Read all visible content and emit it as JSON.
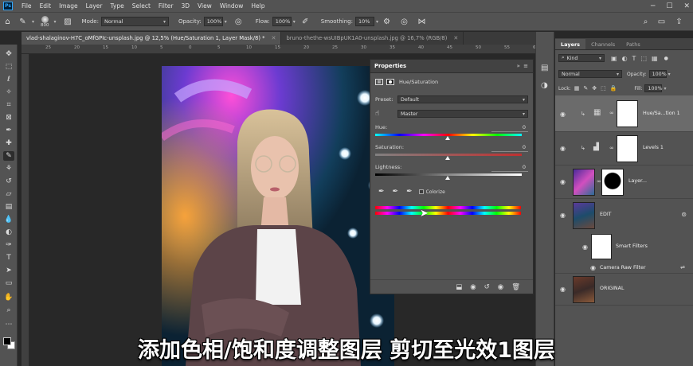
{
  "menu": {
    "app_logo": "Ps",
    "items": [
      "File",
      "Edit",
      "Image",
      "Layer",
      "Type",
      "Select",
      "Filter",
      "3D",
      "View",
      "Window",
      "Help"
    ]
  },
  "options_bar": {
    "brush_size": "800",
    "mode_label": "Mode:",
    "mode_value": "Normal",
    "opacity_label": "Opacity:",
    "opacity_value": "100%",
    "flow_label": "Flow:",
    "flow_value": "100%",
    "smoothing_label": "Smoothing:",
    "smoothing_value": "10%"
  },
  "tabs": [
    {
      "label": "vlad-shalaginov-H7C_oMfGPIc-unsplash.jpg @ 12,5% (Hue/Saturation 1, Layer Mask/8) *",
      "active": true
    },
    {
      "label": "bruno-thethe-wsUIBpUK1A0-unsplash.jpg @ 16,7% (RGB/8)",
      "active": false
    }
  ],
  "ruler_ticks": [
    "25",
    "20",
    "15",
    "10",
    "5",
    "0",
    "5",
    "10",
    "15",
    "20",
    "25",
    "30",
    "35",
    "40",
    "45",
    "50",
    "55",
    "60"
  ],
  "properties": {
    "tab": "Properties",
    "type_label": "Hue/Saturation",
    "preset_label": "Preset:",
    "preset_value": "Default",
    "channel_value": "Master",
    "hue_label": "Hue:",
    "hue_value": "0",
    "saturation_label": "Saturation:",
    "saturation_value": "0",
    "lightness_label": "Lightness:",
    "lightness_value": "0",
    "colorize_label": "Colorize"
  },
  "layers_panel": {
    "tabs": [
      "Layers",
      "Channels",
      "Paths"
    ],
    "kind_label": "Kind",
    "blend_mode": "Normal",
    "opacity_label": "Opacity:",
    "opacity_value": "100%",
    "lock_label": "Lock:",
    "fill_label": "Fill:",
    "fill_value": "100%",
    "layers": [
      {
        "name": "Hue/Sa...tion 1"
      },
      {
        "name": "Levels 1"
      },
      {
        "name": "Layer..."
      },
      {
        "name": "EDIT"
      },
      {
        "name": "Smart Filters"
      },
      {
        "name": "Camera Raw Filter"
      },
      {
        "name": "ORIGINAL"
      }
    ]
  },
  "subtitle": "添加色相/饱和度调整图层 剪切至光效1图层",
  "colors": {
    "panel_bg": "#535353",
    "canvas_bg": "#282828",
    "accent": "#31a8ff"
  }
}
